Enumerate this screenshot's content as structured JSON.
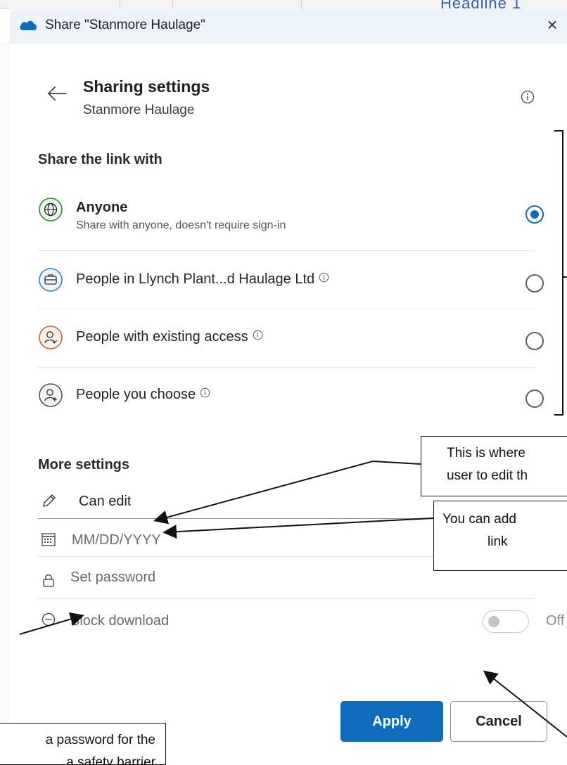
{
  "window": {
    "title": "Share \"Stanmore Haulage\"",
    "close_glyph": "×"
  },
  "background_doc": {
    "heading_fragment": "Headline 1"
  },
  "header": {
    "title": "Sharing settings",
    "subtitle": "Stanmore Haulage"
  },
  "share_section": {
    "title": "Share the link with",
    "options": [
      {
        "label": "Anyone",
        "description": "Share with anyone, doesn't require sign-in",
        "icon": "globe-icon",
        "color": "#2e8b2e",
        "selected": true
      },
      {
        "label": "People in Llynch Plant...d Haulage Ltd",
        "icon": "briefcase-icon",
        "color": "#3a7cc4",
        "selected": false
      },
      {
        "label": "People with existing access",
        "icon": "person-check-icon",
        "color": "#b86a3f",
        "selected": false
      },
      {
        "label": "People you choose",
        "icon": "person-add-icon",
        "color": "#555555",
        "selected": false
      }
    ]
  },
  "more_settings": {
    "title": "More settings",
    "permission": {
      "label": "Can edit",
      "icon": "pencil-icon"
    },
    "expiry": {
      "placeholder": "MM/DD/YYYY",
      "icon": "calendar-icon"
    },
    "password": {
      "placeholder": "Set password",
      "icon": "lock-icon"
    },
    "block_download": {
      "label": "Block download",
      "icon": "minus-circle-icon",
      "state": "Off"
    }
  },
  "buttons": {
    "apply": "Apply",
    "cancel": "Cancel"
  },
  "annotations": {
    "edit_note_line1": "This is where",
    "edit_note_line2": "user to edit th",
    "expiry_note_line1": "You can add",
    "expiry_note_line2": "link",
    "password_note_line1": "a password for the",
    "password_note_line2": "a safety barrier"
  },
  "colors": {
    "accent": "#0f6cbd",
    "titlebar": "#eef3f9"
  }
}
